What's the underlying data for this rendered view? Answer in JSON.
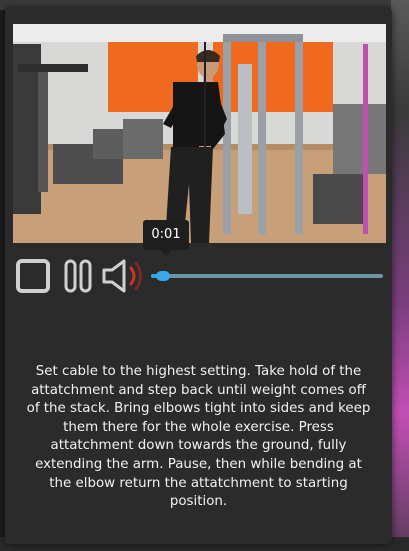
{
  "player": {
    "current_time": "0:01",
    "progress_fraction": 0.05,
    "colors": {
      "track": "#6d95a8",
      "progress": "#36a6e6",
      "control_icon": "#d0d0d0",
      "volume_accent": "#c0392b"
    },
    "icons": {
      "stop": "stop-icon",
      "pause": "pause-icon",
      "volume": "volume-icon"
    }
  },
  "exercise": {
    "description": "Set cable to the highest setting. Take hold of the attatchment and step back until weight comes off of the stack. Bring elbows tight into sides and keep them there for the whole exercise. Press attatchment down towards the ground, fully extending the arm. Pause, then while bending at the elbow return the attatchment to starting position."
  }
}
